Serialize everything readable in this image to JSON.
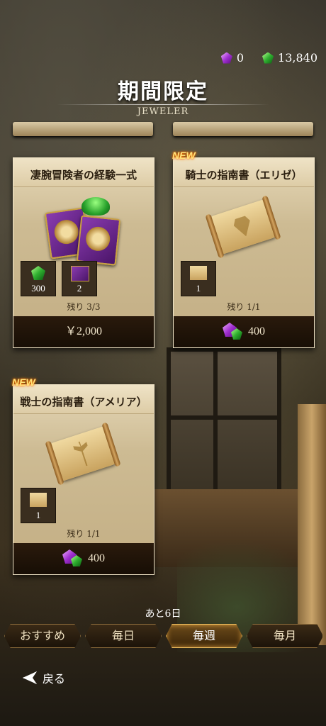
{
  "header": {
    "gem_purple_count": "0",
    "gem_green_count": "13,840",
    "title": "期間限定",
    "subtitle": "JEWELER"
  },
  "cards": [
    {
      "title": "凄腕冒険者の経験一式",
      "new": "",
      "contents": [
        {
          "icon": "green-gem-icon",
          "qty": "300"
        },
        {
          "icon": "purple-book-icon",
          "qty": "2"
        }
      ],
      "remaining": "残り 3/3",
      "price": "￥2,000"
    },
    {
      "title": "騎士の指南書（エリゼ）",
      "new": "NEW",
      "contents": [
        {
          "icon": "scroll-icon",
          "qty": "1"
        }
      ],
      "remaining": "残り 1/1",
      "price": "400"
    },
    {
      "title": "戦士の指南書（アメリア）",
      "new": "NEW",
      "contents": [
        {
          "icon": "scroll-icon",
          "qty": "1"
        }
      ],
      "remaining": "残り 1/1",
      "price": "400"
    }
  ],
  "time_left": "あと6日",
  "tabs": [
    "おすすめ",
    "毎日",
    "毎週",
    "毎月"
  ],
  "active_tab": "毎週",
  "back_label": "戻る"
}
